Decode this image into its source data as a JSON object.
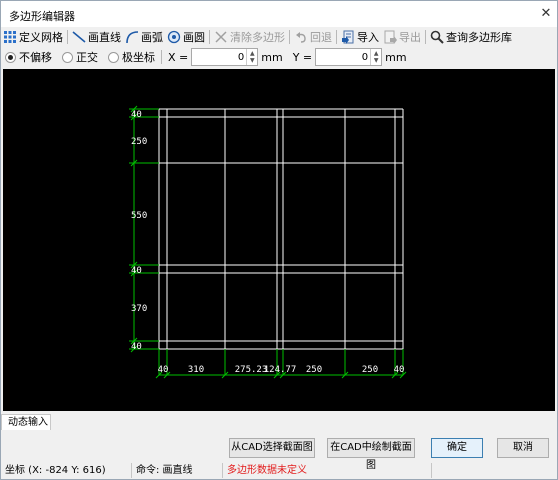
{
  "window": {
    "title": "多边形编辑器",
    "close_glyph": "✕"
  },
  "toolbar": {
    "items": [
      {
        "label": "定义网格",
        "icon": "grid-icon",
        "enabled": true
      },
      {
        "label": "画直线",
        "icon": "line-icon",
        "enabled": true
      },
      {
        "label": "画弧",
        "icon": "arc-icon",
        "enabled": true
      },
      {
        "label": "画圆",
        "icon": "circle-icon",
        "enabled": true
      },
      {
        "label": "清除多边形",
        "icon": "clear-icon",
        "enabled": false
      },
      {
        "label": "回退",
        "icon": "undo-icon",
        "enabled": false
      },
      {
        "label": "导入",
        "icon": "import-icon",
        "enabled": true
      },
      {
        "label": "导出",
        "icon": "export-icon",
        "enabled": false
      },
      {
        "label": "查询多边形库",
        "icon": "search-icon",
        "enabled": true
      }
    ]
  },
  "options": {
    "modes": [
      {
        "label": "不偏移",
        "selected": true
      },
      {
        "label": "正交",
        "selected": false
      },
      {
        "label": "极坐标",
        "selected": false
      }
    ],
    "x_label": "X =",
    "x_value": "0",
    "x_unit": "mm",
    "y_label": "Y =",
    "y_value": "0",
    "y_unit": "mm"
  },
  "canvas": {
    "grid_color": "#ffffff",
    "dim_color": "#00c000",
    "label_color": "#ffffff",
    "vertical_dims": [
      "40",
      "250",
      "550",
      "40",
      "370",
      "40"
    ],
    "horizontal_dims": [
      "40",
      "310",
      "275.23",
      "124.77",
      "250",
      "250",
      "40"
    ]
  },
  "tab": {
    "label": "动态输入"
  },
  "buttons": {
    "from_cad": "从CAD选择截面图",
    "draw_in_cad": "在CAD中绘制截面图",
    "ok": "确定",
    "cancel": "取消"
  },
  "status": {
    "coords": "坐标 (X: -824 Y: 616)",
    "command": "命令: 画直线",
    "message": "多边形数据未定义",
    "message_color": "#e21b1b"
  }
}
